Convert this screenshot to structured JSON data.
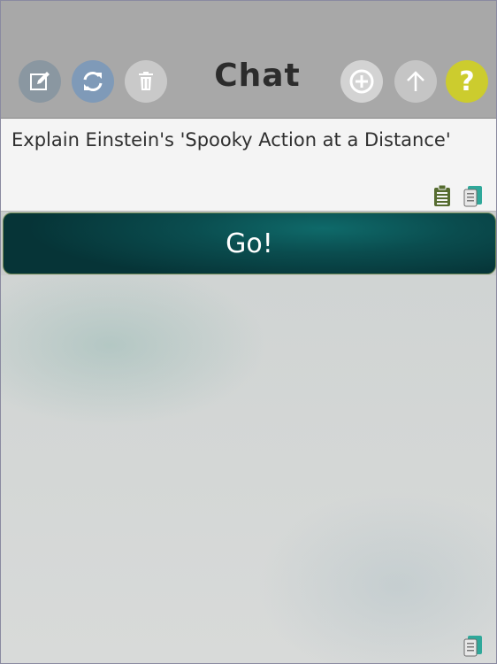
{
  "header": {
    "title": "Chat",
    "help_label": "?",
    "buttons": {
      "edit": "pencil-square-icon",
      "refresh": "refresh-icon",
      "delete": "trash-icon",
      "add": "plus-circle-icon",
      "upload": "arrow-up-icon",
      "help": "question-icon"
    }
  },
  "prompt": {
    "text": "Explain Einstein's 'Spooky Action at a Distance'"
  },
  "actions": {
    "go_label": "Go!"
  },
  "response": {
    "text": ""
  },
  "colors": {
    "topbar": "#a8a8a8",
    "help": "#cccc2e",
    "go_button": "#0a4d4f",
    "paste_icon": "#556b2f",
    "copy_icon": "#2fa89a"
  }
}
